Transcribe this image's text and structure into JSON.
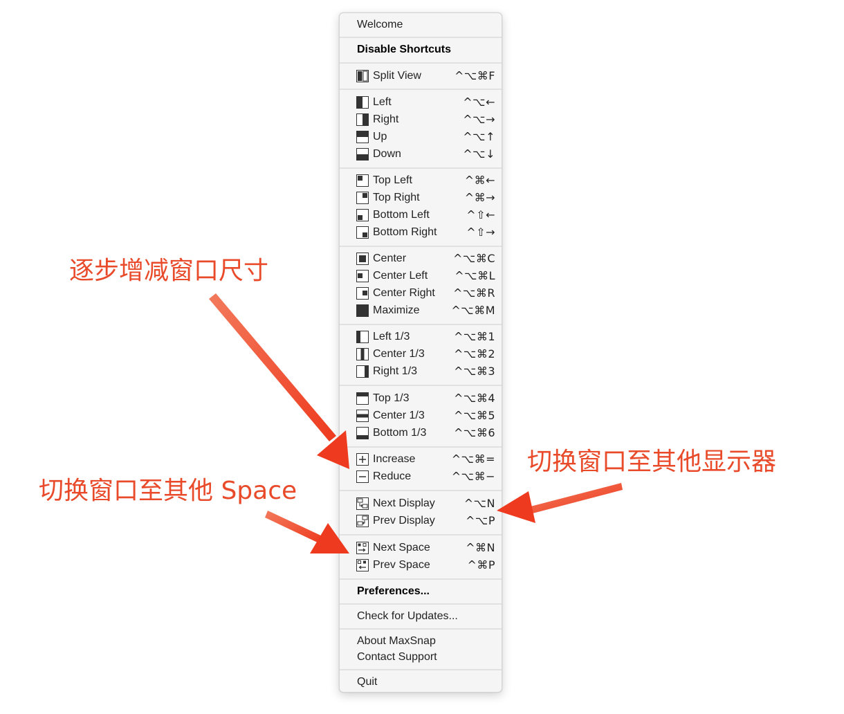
{
  "menu": {
    "welcome": "Welcome",
    "disable_shortcuts": "Disable Shortcuts",
    "split_view": {
      "label": "Split View",
      "shortcut": "^⌥⌘F",
      "icon": "split-view-icon"
    },
    "halves": [
      {
        "label": "Left",
        "shortcut": "^⌥←",
        "icon": "left-half-icon"
      },
      {
        "label": "Right",
        "shortcut": "^⌥→",
        "icon": "right-half-icon"
      },
      {
        "label": "Up",
        "shortcut": "^⌥↑",
        "icon": "top-half-icon"
      },
      {
        "label": "Down",
        "shortcut": "^⌥↓",
        "icon": "bottom-half-icon"
      }
    ],
    "quarters": [
      {
        "label": "Top Left",
        "shortcut": "^⌘←",
        "icon": "top-left-icon"
      },
      {
        "label": "Top Right",
        "shortcut": "^⌘→",
        "icon": "top-right-icon"
      },
      {
        "label": "Bottom Left",
        "shortcut": "^⇧←",
        "icon": "bottom-left-icon"
      },
      {
        "label": "Bottom Right",
        "shortcut": "^⇧→",
        "icon": "bottom-right-icon"
      }
    ],
    "centers": [
      {
        "label": "Center",
        "shortcut": "^⌥⌘C",
        "icon": "center-icon"
      },
      {
        "label": "Center Left",
        "shortcut": "^⌥⌘L",
        "icon": "center-left-icon"
      },
      {
        "label": "Center Right",
        "shortcut": "^⌥⌘R",
        "icon": "center-right-icon"
      },
      {
        "label": "Maximize",
        "shortcut": "^⌥⌘M",
        "icon": "maximize-icon"
      }
    ],
    "thirds_v": [
      {
        "label": "Left 1/3",
        "shortcut": "^⌥⌘1",
        "icon": "left-third-icon"
      },
      {
        "label": "Center 1/3",
        "shortcut": "^⌥⌘2",
        "icon": "center-third-icon"
      },
      {
        "label": "Right 1/3",
        "shortcut": "^⌥⌘3",
        "icon": "right-third-icon"
      }
    ],
    "thirds_h": [
      {
        "label": "Top 1/3",
        "shortcut": "^⌥⌘4",
        "icon": "top-third-icon"
      },
      {
        "label": "Center 1/3",
        "shortcut": "^⌥⌘5",
        "icon": "middle-third-icon"
      },
      {
        "label": "Bottom 1/3",
        "shortcut": "^⌥⌘6",
        "icon": "bottom-third-icon"
      }
    ],
    "sizing": [
      {
        "label": "Increase",
        "shortcut": "^⌥⌘=",
        "icon": "plus-icon"
      },
      {
        "label": "Reduce",
        "shortcut": "^⌥⌘−",
        "icon": "minus-icon"
      }
    ],
    "displays": [
      {
        "label": "Next Display",
        "shortcut": "^⌥N",
        "icon": "next-display-icon"
      },
      {
        "label": "Prev Display",
        "shortcut": "^⌥P",
        "icon": "prev-display-icon"
      }
    ],
    "spaces": [
      {
        "label": "Next Space",
        "shortcut": "^⌘N",
        "icon": "next-space-icon"
      },
      {
        "label": "Prev Space",
        "shortcut": "^⌘P",
        "icon": "prev-space-icon"
      }
    ],
    "preferences": "Preferences...",
    "check_updates": "Check for Updates...",
    "about": "About MaxSnap",
    "contact": "Contact Support",
    "quit": "Quit"
  },
  "annotations": {
    "resize": "逐步增减窗口尺寸",
    "space": "切换窗口至其他 Space",
    "display": "切换窗口至其他显示器"
  },
  "colors": {
    "annotation": "#e84a2a",
    "arrow": "#ee3a1e"
  }
}
